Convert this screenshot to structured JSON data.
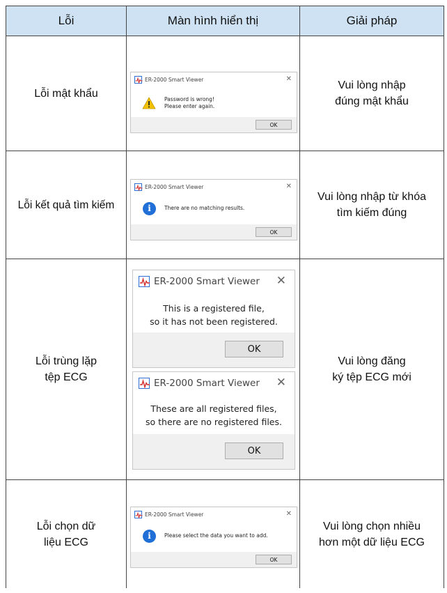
{
  "table": {
    "headers": [
      "Lỗi",
      "Màn hình hiển thị",
      "Giải pháp"
    ],
    "rows": [
      {
        "error": "Lỗi mật khẩu",
        "solution": "Vui lòng nhập\nđúng mật khẩu",
        "dialogs": [
          {
            "title": "ER-2000 Smart Viewer",
            "icon": "warning-icon",
            "message": "Password is wrong!\nPlease enter again.",
            "button": "OK",
            "close": "✕"
          }
        ]
      },
      {
        "error": "Lỗi kết quả tìm kiếm",
        "solution": "Vui lòng nhập từ khóa\ntìm kiếm đúng",
        "dialogs": [
          {
            "title": "ER-2000 Smart Viewer",
            "icon": "info-icon",
            "message": "There are no matching results.",
            "button": "OK",
            "close": "✕"
          }
        ]
      },
      {
        "error": "Lỗi trùng lặp\ntệp ECG",
        "solution": "Vui lòng đăng\nký tệp ECG mới",
        "dialogs": [
          {
            "title": "ER-2000 Smart Viewer",
            "message": "This is a registered file,\nso it has not been registered.",
            "button": "OK",
            "close": "✕"
          },
          {
            "title": "ER-2000 Smart Viewer",
            "message": "These are all registered files,\nso there are no registered files.",
            "button": "OK",
            "close": "✕"
          }
        ]
      },
      {
        "error": "Lỗi chọn dữ\nliệu ECG",
        "solution": "Vui lòng chọn nhiều\nhơn một dữ liệu ECG",
        "dialogs": [
          {
            "title": "ER-2000 Smart Viewer",
            "icon": "info-icon",
            "message": "Please select the data you want to add.",
            "button": "OK",
            "close": "✕"
          }
        ]
      }
    ]
  },
  "colors": {
    "header_bg": "#cfe2f3",
    "info_blue": "#1f6fd6",
    "warning_yellow": "#f2c200"
  }
}
